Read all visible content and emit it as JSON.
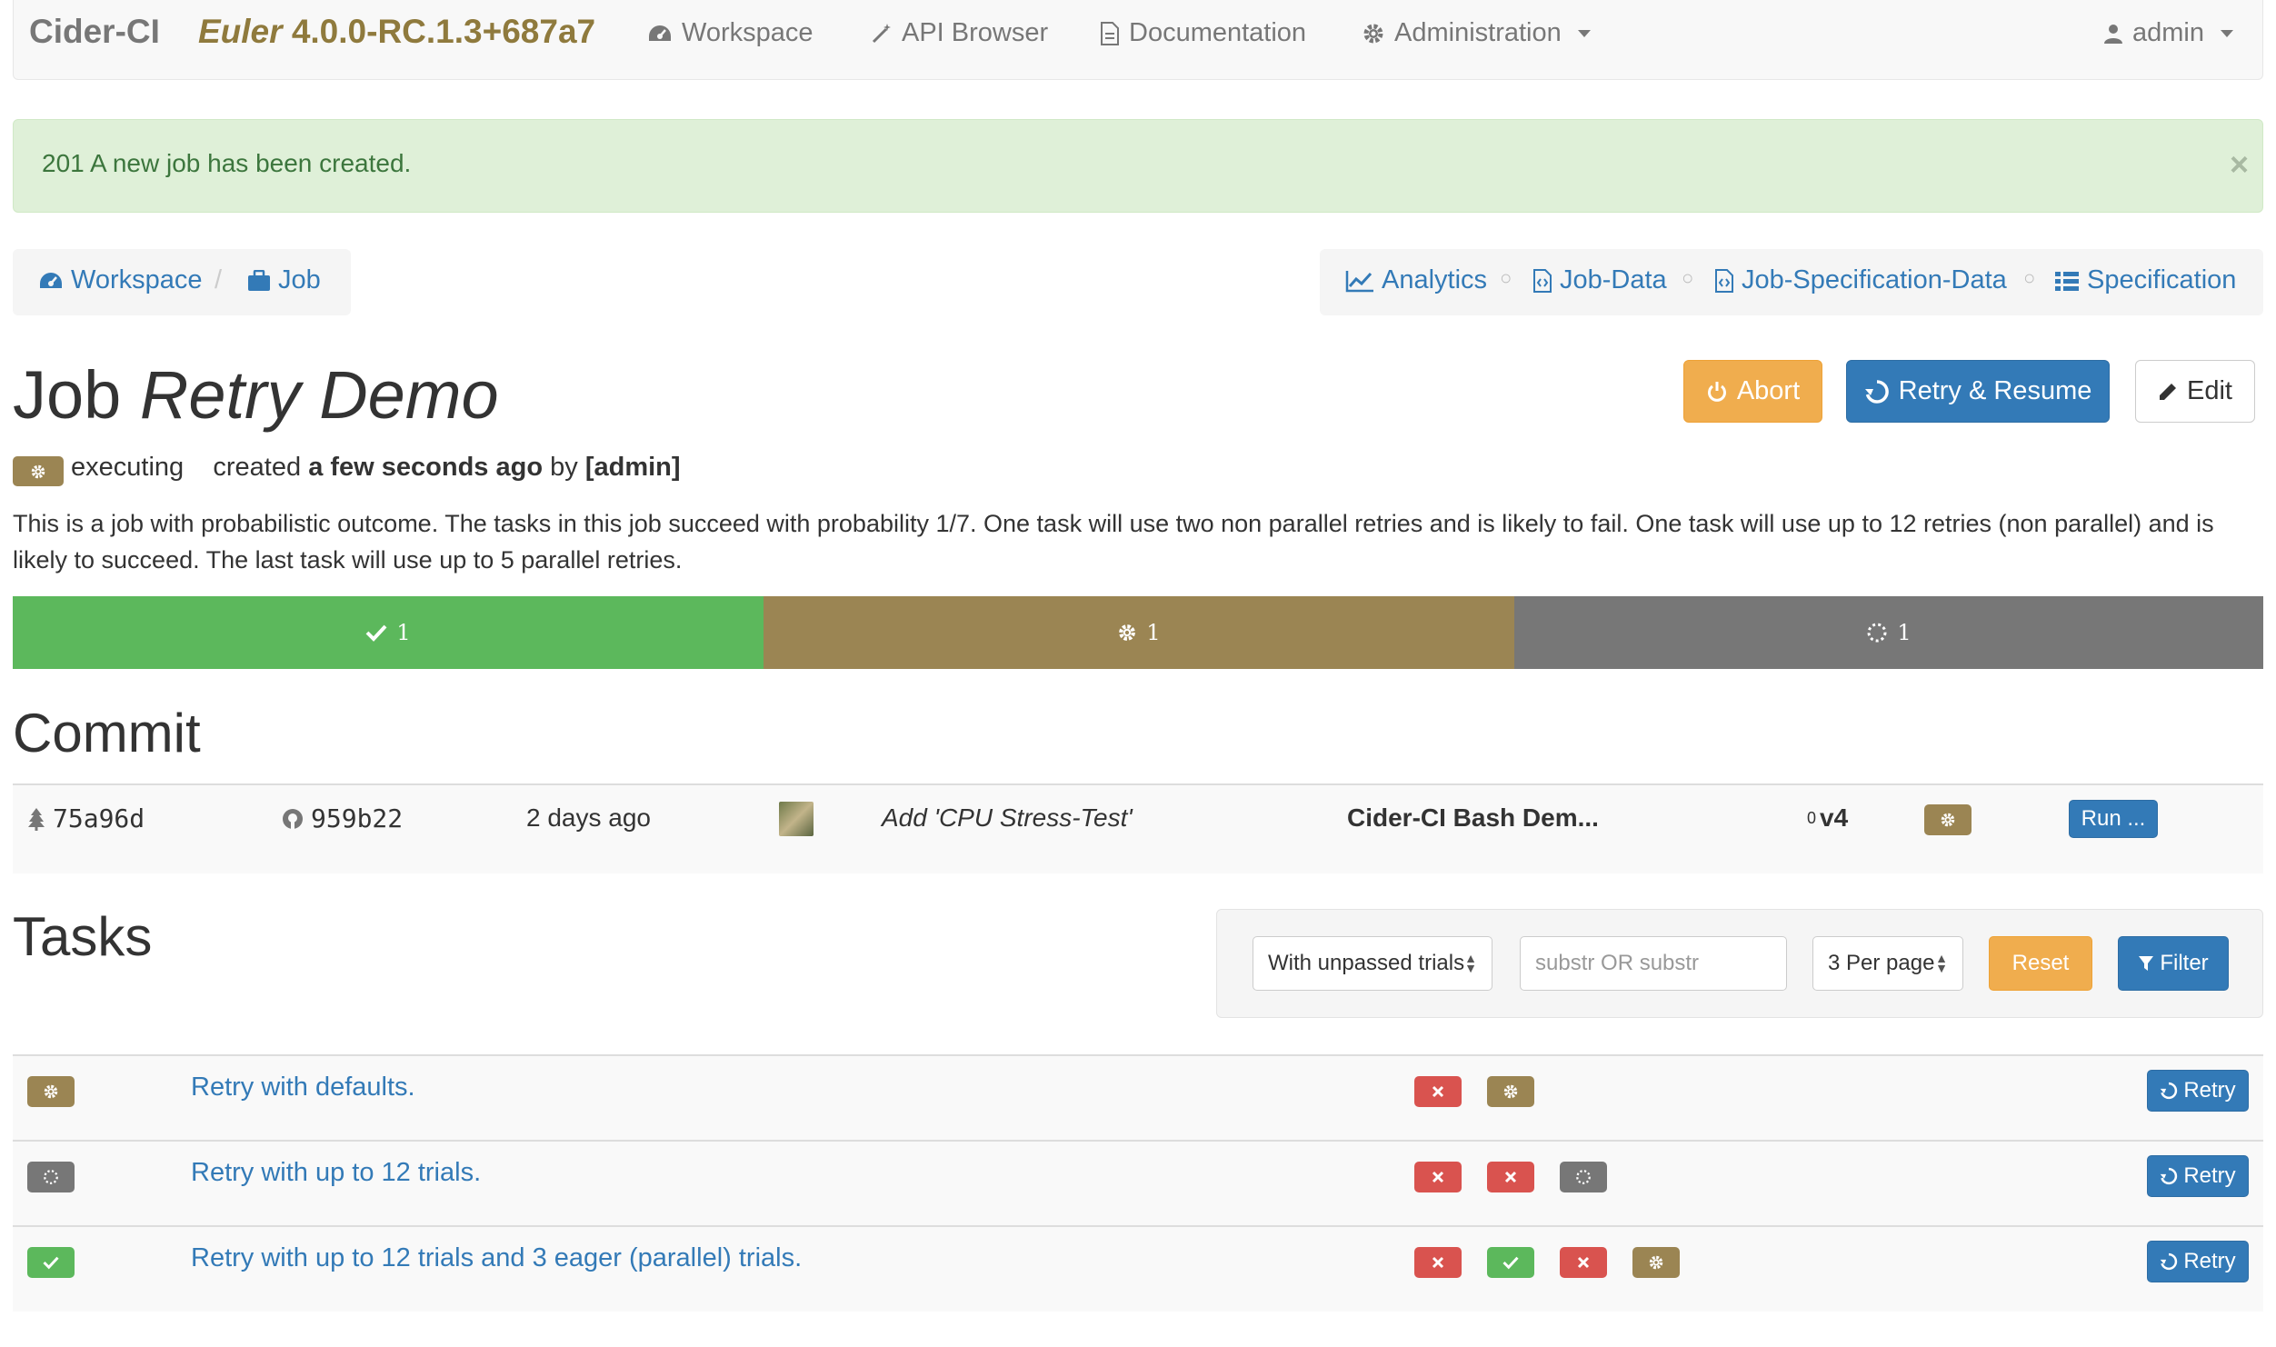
{
  "navbar": {
    "brand": "Cider-CI",
    "version_name": "Euler",
    "version_number": "4.0.0-RC.1.3+687a7",
    "items": {
      "workspace": "Workspace",
      "api_browser": "API Browser",
      "documentation": "Documentation",
      "administration": "Administration"
    },
    "user": "admin"
  },
  "alert": {
    "message": "201 A new job has been created.",
    "close": "×"
  },
  "breadcrumb": {
    "workspace": "Workspace",
    "separator": "/",
    "job": "Job"
  },
  "job_tabs": {
    "analytics": "Analytics",
    "job_data": "Job-Data",
    "job_specification_data": "Job-Specification-Data",
    "specification": "Specification",
    "separator": "○"
  },
  "job": {
    "title_prefix": "Job",
    "title_name": "Retry Demo",
    "state": "executing",
    "created_label": "created",
    "created_when": "a few seconds ago",
    "created_by_label": "by",
    "created_by": "[admin]",
    "description": "This is a job with probabilistic outcome. The tasks in this job succeed with probability 1/7. One task will use two non parallel retries and is likely to fail. One task will use up to 12 retries (non parallel) and is likely to succeed. The last task will use up to 5 parallel retries."
  },
  "actions": {
    "abort": "Abort",
    "retry_resume": "Retry & Resume",
    "edit": "Edit"
  },
  "progress": {
    "passed": "1",
    "executing": "1",
    "pending": "1"
  },
  "colors": {
    "passed": "#5cb85c",
    "executing": "#9b8553",
    "pending": "#777777",
    "failed": "#d9534f",
    "primary": "#337ab7",
    "warning": "#f0ad4e"
  },
  "commit_section": {
    "title": "Commit",
    "tree_id": "75a96d",
    "commit_id": "959b22",
    "when": "2 days ago",
    "message": "Add 'CPU Stress-Test'",
    "repository": "Cider-CI Bash Dem...",
    "branch_count": "0",
    "branch": "v4",
    "run_label": "Run ..."
  },
  "tasks_section": {
    "title": "Tasks",
    "filter": {
      "state_select": "With unpassed trials",
      "search_placeholder": "substr OR substr",
      "per_page_select": "3 Per page",
      "reset_label": "Reset",
      "filter_label": "Filter"
    },
    "retry_label": "Retry",
    "rows": [
      {
        "state": "executing",
        "name": "Retry with defaults.",
        "trials": [
          "failed",
          "executing"
        ]
      },
      {
        "state": "pending",
        "name": "Retry with up to 12 trials.",
        "trials": [
          "failed",
          "failed",
          "pending"
        ]
      },
      {
        "state": "passed",
        "name": "Retry with up to 12 trials and 3 eager (parallel) trials.",
        "trials": [
          "failed",
          "passed",
          "failed",
          "executing"
        ]
      }
    ]
  }
}
